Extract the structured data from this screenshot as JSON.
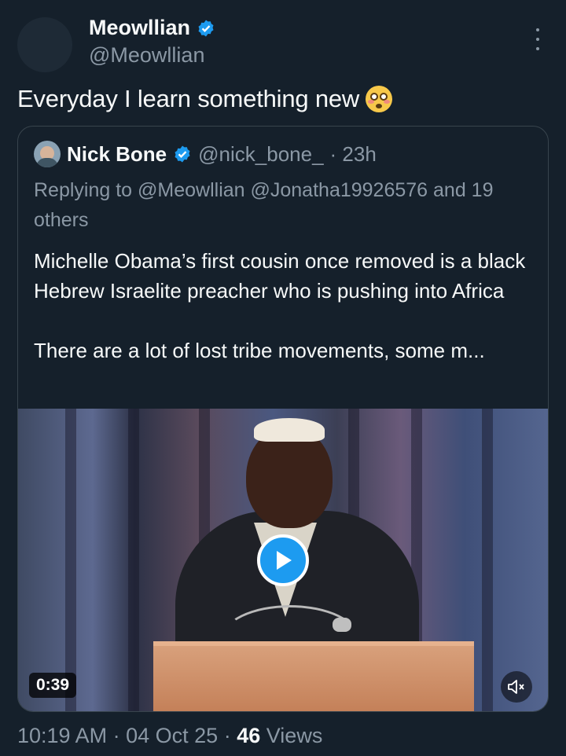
{
  "tweet": {
    "author_name": "Meowllian",
    "author_handle": "@Meowllian",
    "text": "Everyday I learn something new",
    "emoji": "flushed-face-emoji"
  },
  "quote": {
    "author_name": "Nick Bone",
    "author_handle": "@nick_bone_",
    "time_ago": "· 23h",
    "replying_to": "Replying to @Meowllian @Jonatha19926576 and 19 others",
    "body_lines": [
      "Michelle Obama’s first cousin once removed is a black Hebrew Israelite preacher who is pushing into Africa",
      "There are a lot of lost tribe movements, some m..."
    ],
    "video": {
      "duration": "0:39",
      "play_icon": "play-icon",
      "mute_icon": "muted-speaker-icon"
    }
  },
  "meta": {
    "time": "10:19 AM",
    "sep1": "·",
    "date": "04 Oct 25",
    "sep2": "·",
    "views_count": "46",
    "views_label": "Views"
  },
  "colors": {
    "background": "#15202b",
    "text": "#f7f9f9",
    "secondary": "#8b98a5",
    "accent": "#1d9bf0",
    "border": "#38444d"
  }
}
